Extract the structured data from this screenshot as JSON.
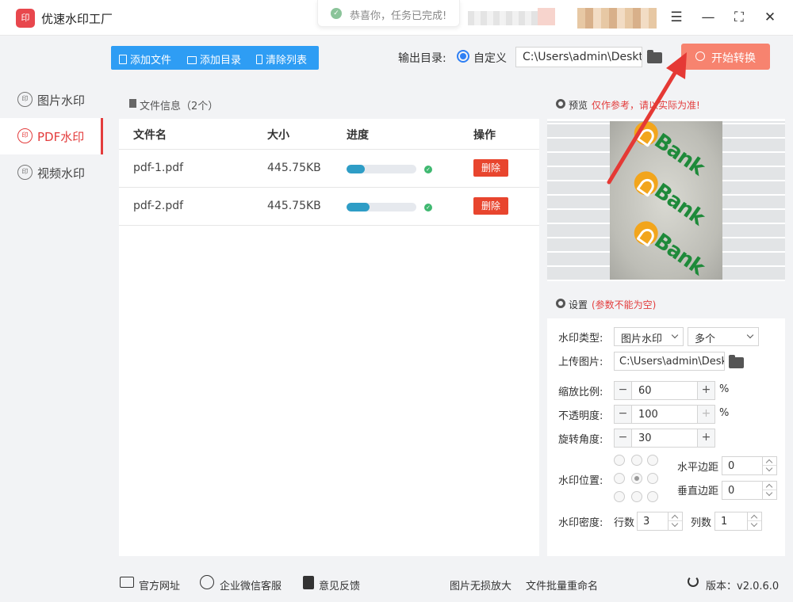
{
  "app": {
    "title": "优速水印工厂",
    "logo_text": "印"
  },
  "toast": {
    "message": "恭喜你，任务已完成!"
  },
  "window_controls": [
    "menu-icon",
    "minimize-icon",
    "maximize-icon",
    "close-icon"
  ],
  "sidebar": {
    "items": [
      {
        "label": "图片水印",
        "icon": "印",
        "active": false
      },
      {
        "label": "PDF水印",
        "icon": "印",
        "active": true
      },
      {
        "label": "视频水印",
        "icon": "印",
        "active": false
      }
    ]
  },
  "toolbar": {
    "add_file": "添加文件",
    "add_dir": "添加目录",
    "clear_list": "清除列表",
    "output_label": "输出目录:",
    "radio_label": "自定义",
    "output_path": "C:\\Users\\admin\\Desktop",
    "start_button": "开始转换"
  },
  "file_panel": {
    "title": "文件信息（2个）",
    "columns": {
      "name": "文件名",
      "size": "大小",
      "progress": "进度",
      "action": "操作"
    },
    "rows": [
      {
        "name": "pdf-1.pdf",
        "size": "445.75KB",
        "progress": 0.26,
        "action": "删除"
      },
      {
        "name": "pdf-2.pdf",
        "size": "445.75KB",
        "progress": 0.33,
        "action": "删除"
      }
    ]
  },
  "preview": {
    "title": "预览",
    "note": "仅作参考，请以实际为准!",
    "watermark_text": "Bank"
  },
  "settings": {
    "title": "设置",
    "note": "(参数不能为空)",
    "watermark_type_label": "水印类型:",
    "watermark_type": "图片水印",
    "watermark_count": "多个",
    "upload_label": "上传图片:",
    "upload_path": "C:\\Users\\admin\\Desktop",
    "scale_label": "缩放比例:",
    "scale": "60",
    "opacity_label": "不透明度:",
    "opacity": "100",
    "rotate_label": "旋转角度:",
    "rotate": "30",
    "percent": "%",
    "position_label": "水印位置:",
    "h_margin_label": "水平边距",
    "h_margin": "0",
    "v_margin_label": "垂直边距",
    "v_margin": "0",
    "density_label": "水印密度:",
    "rows_label": "行数",
    "rows": "3",
    "cols_label": "列数",
    "cols": "1"
  },
  "footer": {
    "website": "官方网址",
    "wechat": "企业微信客服",
    "feedback": "意见反馈",
    "enlarge": "图片无损放大",
    "rename": "文件批量重命名",
    "version": "版本：v2.0.6.0"
  },
  "colors": {
    "accent": "#2e9df4",
    "danger": "#e8452e",
    "active_nav": "#e33c3c",
    "start_button": "#f7836f"
  }
}
